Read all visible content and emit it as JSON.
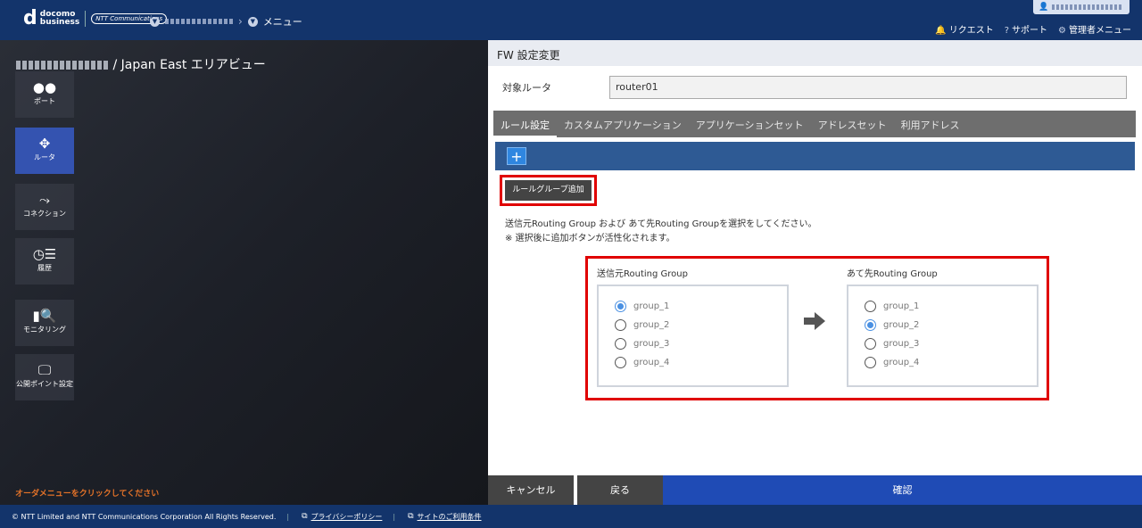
{
  "header": {
    "logo_d": "d",
    "logo_line1": "docomo",
    "logo_line2": "business",
    "ntt_badge": "NTT Communications",
    "crumb_menu": "メニュー",
    "links": {
      "request": "リクエスト",
      "support": "サポート",
      "admin": "管理者メニュー"
    }
  },
  "left": {
    "area_title": "/ Japan East エリアビュー",
    "nav": [
      {
        "label": "ポート",
        "icon": "port-icon"
      },
      {
        "label": "ルータ",
        "icon": "router-icon"
      },
      {
        "label": "コネクション",
        "icon": "connection-icon"
      },
      {
        "label": "履歴",
        "icon": "history-icon"
      },
      {
        "label": "モニタリング",
        "icon": "monitoring-icon"
      },
      {
        "label": "公開ポイント設定",
        "icon": "public-point-icon"
      }
    ],
    "order_message": "オーダメニューをクリックしてください"
  },
  "panel": {
    "title": "FW 設定変更",
    "router_label": "対象ルータ",
    "router_value": "router01",
    "tabs": [
      "ルール設定",
      "カスタムアプリケーション",
      "アプリケーションセット",
      "アドレスセット",
      "利用アドレス"
    ],
    "plus": "+",
    "add_group_button": "ルールグループ追加",
    "instruction1": "送信元Routing Group および あて先Routing Groupを選択をしてください。",
    "instruction2": "※ 選択後に追加ボタンが活性化されます。",
    "source": {
      "title": "送信元Routing Group",
      "options": [
        "group_1",
        "group_2",
        "group_3",
        "group_4"
      ],
      "selected": "group_1"
    },
    "dest": {
      "title": "あて先Routing Group",
      "options": [
        "group_1",
        "group_2",
        "group_3",
        "group_4"
      ],
      "selected": "group_2"
    }
  },
  "buttons": {
    "cancel": "キャンセル",
    "back": "戻る",
    "confirm": "確認"
  },
  "footer": {
    "copyright": "© NTT Limited and NTT Communications Corporation All Rights Reserved.",
    "privacy": "プライバシーポリシー",
    "terms": "サイトのご利用条件"
  },
  "colors": {
    "header_bg": "#13346b",
    "active_nav": "#3453b0",
    "confirm_bg": "#1f4bb5",
    "highlight": "#e00000",
    "order_msg": "#e57328"
  }
}
